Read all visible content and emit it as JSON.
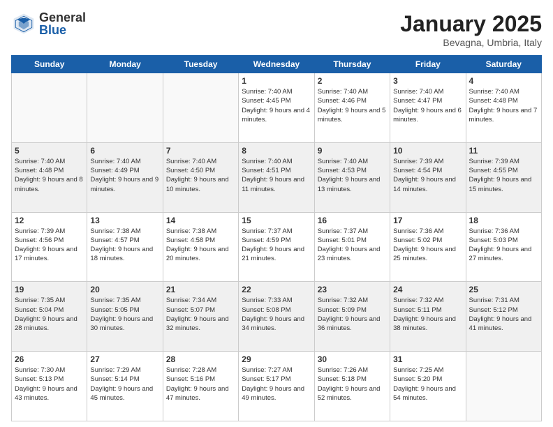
{
  "header": {
    "logo": {
      "general": "General",
      "blue": "Blue"
    },
    "title": "January 2025",
    "location": "Bevagna, Umbria, Italy"
  },
  "days_of_week": [
    "Sunday",
    "Monday",
    "Tuesday",
    "Wednesday",
    "Thursday",
    "Friday",
    "Saturday"
  ],
  "weeks": [
    [
      {
        "day": "",
        "info": ""
      },
      {
        "day": "",
        "info": ""
      },
      {
        "day": "",
        "info": ""
      },
      {
        "day": "1",
        "info": "Sunrise: 7:40 AM\nSunset: 4:45 PM\nDaylight: 9 hours\nand 4 minutes."
      },
      {
        "day": "2",
        "info": "Sunrise: 7:40 AM\nSunset: 4:46 PM\nDaylight: 9 hours\nand 5 minutes."
      },
      {
        "day": "3",
        "info": "Sunrise: 7:40 AM\nSunset: 4:47 PM\nDaylight: 9 hours\nand 6 minutes."
      },
      {
        "day": "4",
        "info": "Sunrise: 7:40 AM\nSunset: 4:48 PM\nDaylight: 9 hours\nand 7 minutes."
      }
    ],
    [
      {
        "day": "5",
        "info": "Sunrise: 7:40 AM\nSunset: 4:48 PM\nDaylight: 9 hours\nand 8 minutes."
      },
      {
        "day": "6",
        "info": "Sunrise: 7:40 AM\nSunset: 4:49 PM\nDaylight: 9 hours\nand 9 minutes."
      },
      {
        "day": "7",
        "info": "Sunrise: 7:40 AM\nSunset: 4:50 PM\nDaylight: 9 hours\nand 10 minutes."
      },
      {
        "day": "8",
        "info": "Sunrise: 7:40 AM\nSunset: 4:51 PM\nDaylight: 9 hours\nand 11 minutes."
      },
      {
        "day": "9",
        "info": "Sunrise: 7:40 AM\nSunset: 4:53 PM\nDaylight: 9 hours\nand 13 minutes."
      },
      {
        "day": "10",
        "info": "Sunrise: 7:39 AM\nSunset: 4:54 PM\nDaylight: 9 hours\nand 14 minutes."
      },
      {
        "day": "11",
        "info": "Sunrise: 7:39 AM\nSunset: 4:55 PM\nDaylight: 9 hours\nand 15 minutes."
      }
    ],
    [
      {
        "day": "12",
        "info": "Sunrise: 7:39 AM\nSunset: 4:56 PM\nDaylight: 9 hours\nand 17 minutes."
      },
      {
        "day": "13",
        "info": "Sunrise: 7:38 AM\nSunset: 4:57 PM\nDaylight: 9 hours\nand 18 minutes."
      },
      {
        "day": "14",
        "info": "Sunrise: 7:38 AM\nSunset: 4:58 PM\nDaylight: 9 hours\nand 20 minutes."
      },
      {
        "day": "15",
        "info": "Sunrise: 7:37 AM\nSunset: 4:59 PM\nDaylight: 9 hours\nand 21 minutes."
      },
      {
        "day": "16",
        "info": "Sunrise: 7:37 AM\nSunset: 5:01 PM\nDaylight: 9 hours\nand 23 minutes."
      },
      {
        "day": "17",
        "info": "Sunrise: 7:36 AM\nSunset: 5:02 PM\nDaylight: 9 hours\nand 25 minutes."
      },
      {
        "day": "18",
        "info": "Sunrise: 7:36 AM\nSunset: 5:03 PM\nDaylight: 9 hours\nand 27 minutes."
      }
    ],
    [
      {
        "day": "19",
        "info": "Sunrise: 7:35 AM\nSunset: 5:04 PM\nDaylight: 9 hours\nand 28 minutes."
      },
      {
        "day": "20",
        "info": "Sunrise: 7:35 AM\nSunset: 5:05 PM\nDaylight: 9 hours\nand 30 minutes."
      },
      {
        "day": "21",
        "info": "Sunrise: 7:34 AM\nSunset: 5:07 PM\nDaylight: 9 hours\nand 32 minutes."
      },
      {
        "day": "22",
        "info": "Sunrise: 7:33 AM\nSunset: 5:08 PM\nDaylight: 9 hours\nand 34 minutes."
      },
      {
        "day": "23",
        "info": "Sunrise: 7:32 AM\nSunset: 5:09 PM\nDaylight: 9 hours\nand 36 minutes."
      },
      {
        "day": "24",
        "info": "Sunrise: 7:32 AM\nSunset: 5:11 PM\nDaylight: 9 hours\nand 38 minutes."
      },
      {
        "day": "25",
        "info": "Sunrise: 7:31 AM\nSunset: 5:12 PM\nDaylight: 9 hours\nand 41 minutes."
      }
    ],
    [
      {
        "day": "26",
        "info": "Sunrise: 7:30 AM\nSunset: 5:13 PM\nDaylight: 9 hours\nand 43 minutes."
      },
      {
        "day": "27",
        "info": "Sunrise: 7:29 AM\nSunset: 5:14 PM\nDaylight: 9 hours\nand 45 minutes."
      },
      {
        "day": "28",
        "info": "Sunrise: 7:28 AM\nSunset: 5:16 PM\nDaylight: 9 hours\nand 47 minutes."
      },
      {
        "day": "29",
        "info": "Sunrise: 7:27 AM\nSunset: 5:17 PM\nDaylight: 9 hours\nand 49 minutes."
      },
      {
        "day": "30",
        "info": "Sunrise: 7:26 AM\nSunset: 5:18 PM\nDaylight: 9 hours\nand 52 minutes."
      },
      {
        "day": "31",
        "info": "Sunrise: 7:25 AM\nSunset: 5:20 PM\nDaylight: 9 hours\nand 54 minutes."
      },
      {
        "day": "",
        "info": ""
      }
    ]
  ]
}
